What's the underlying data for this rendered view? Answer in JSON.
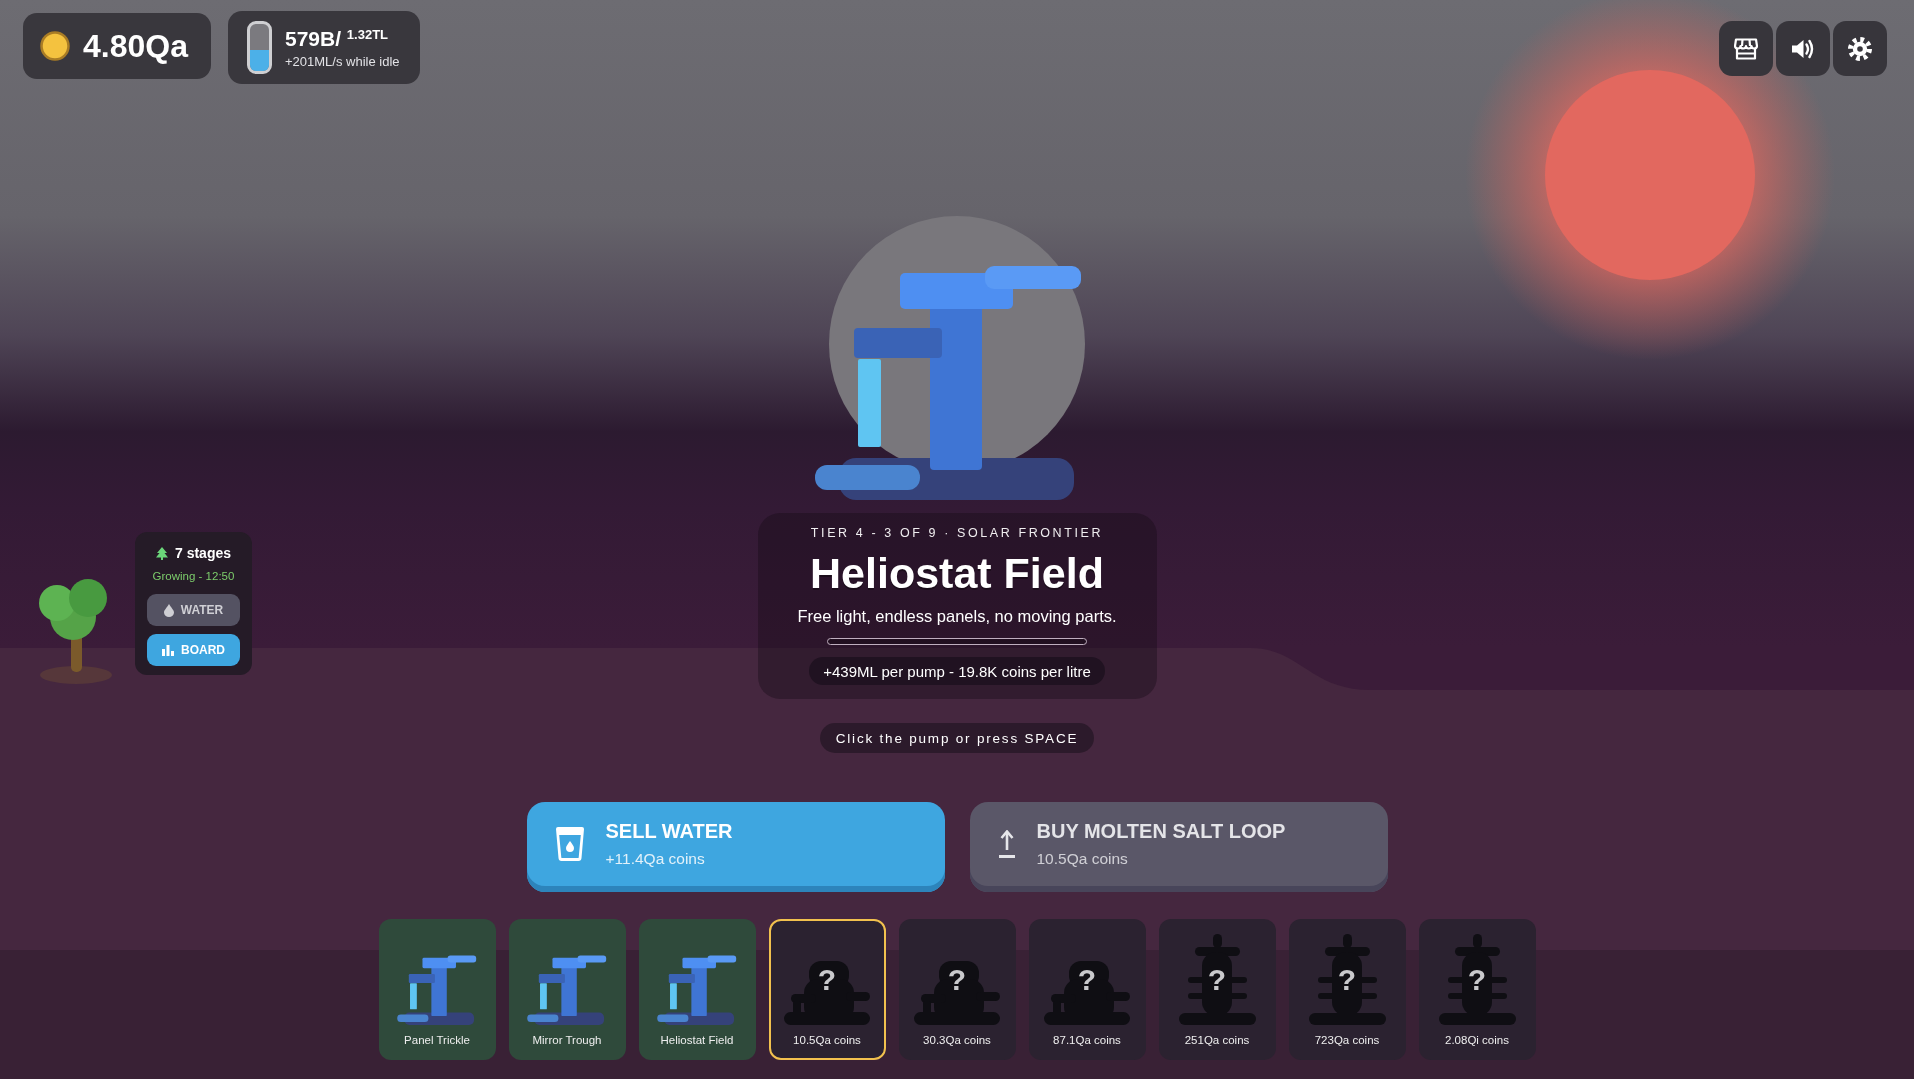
{
  "hud": {
    "coins": "4.80Qa",
    "water": {
      "amount": "579B/ $^{1.32TL}$",
      "rate": "+201ML/s while idle",
      "level": 0.44
    }
  },
  "tree": {
    "title": "7 stages",
    "status": "Growing - 12:50",
    "buttons": [
      {
        "label": "WATER",
        "disabled": true
      },
      {
        "label": "BOARD",
        "disabled": false
      }
    ]
  },
  "card": {
    "subtitle": "TIER 4 - 3 OF 9 · SOLAR FRONTIER",
    "title": "Heliostat Field",
    "description": "Free light, endless panels, no moving parts.",
    "stats": "+439ML per pump - 19.8K coins per litre"
  },
  "hint": "Click the pump or press SPACE",
  "actions": [
    {
      "title": "SELL WATER",
      "detail": "+11.4Qa coins",
      "disabled": false
    },
    {
      "title": "BUY MOLTEN SALT LOOP",
      "detail": "10.5Qa coins",
      "disabled": true
    }
  ],
  "pumps": [
    {
      "label": "Panel Trickle",
      "kind": "pump",
      "owned": true,
      "selected": false
    },
    {
      "label": "Mirror Trough",
      "kind": "pump",
      "owned": true,
      "selected": false
    },
    {
      "label": "Heliostat Field",
      "kind": "pump",
      "owned": true,
      "selected": false
    },
    {
      "label": "10.5Qa coins",
      "kind": "mound",
      "owned": false,
      "selected": true,
      "glyph": "?"
    },
    {
      "label": "30.3Qa coins",
      "kind": "mound",
      "owned": false,
      "selected": false,
      "glyph": "?"
    },
    {
      "label": "87.1Qa coins",
      "kind": "mound",
      "owned": false,
      "selected": false,
      "glyph": "?"
    },
    {
      "label": "251Qa coins",
      "kind": "tower",
      "owned": false,
      "selected": false,
      "glyph": "?"
    },
    {
      "label": "723Qa coins",
      "kind": "tower",
      "owned": false,
      "selected": false,
      "glyph": "?"
    },
    {
      "label": "2.08Qi coins",
      "kind": "tower",
      "owned": false,
      "selected": false,
      "glyph": "?"
    }
  ]
}
